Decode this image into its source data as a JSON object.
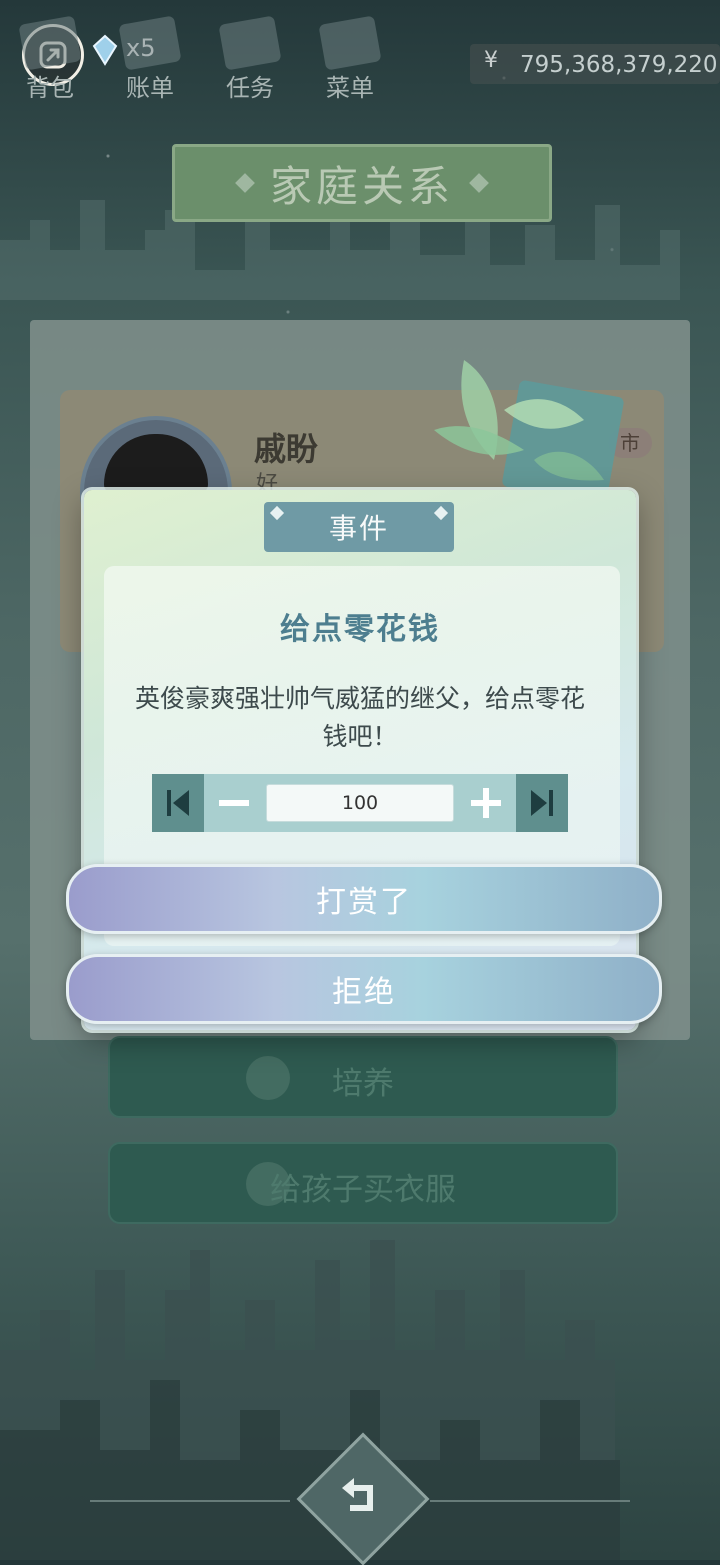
{
  "topbar": {
    "gem_count": "x5",
    "nav": [
      {
        "label": "背包",
        "icon": "bag-icon"
      },
      {
        "label": "账单",
        "icon": "bill-icon"
      },
      {
        "label": "任务",
        "icon": "task-icon"
      },
      {
        "label": "菜单",
        "icon": "menu-icon"
      }
    ],
    "money_symbol": "¥",
    "money": "795,368,379,220"
  },
  "page_title": "家庭关系",
  "character": {
    "name": "戚盼",
    "subtitle": "好",
    "city_tag": "市"
  },
  "background_buttons": {
    "nurture": "培养",
    "buy_clothes": "给孩子买衣服"
  },
  "dialog": {
    "tab": "事件",
    "title": "给点零花钱",
    "description": "英俊豪爽强壮帅气威猛的继父，给点零花钱吧！",
    "amount": "100",
    "confirm": "打赏了",
    "reject": "拒绝"
  },
  "colors": {
    "dialog_accent": "#6f9aa5",
    "button_gradient_start": "#9a9ccc",
    "button_gradient_end": "#8fb0c8",
    "bg_button": "#2e5a50"
  }
}
